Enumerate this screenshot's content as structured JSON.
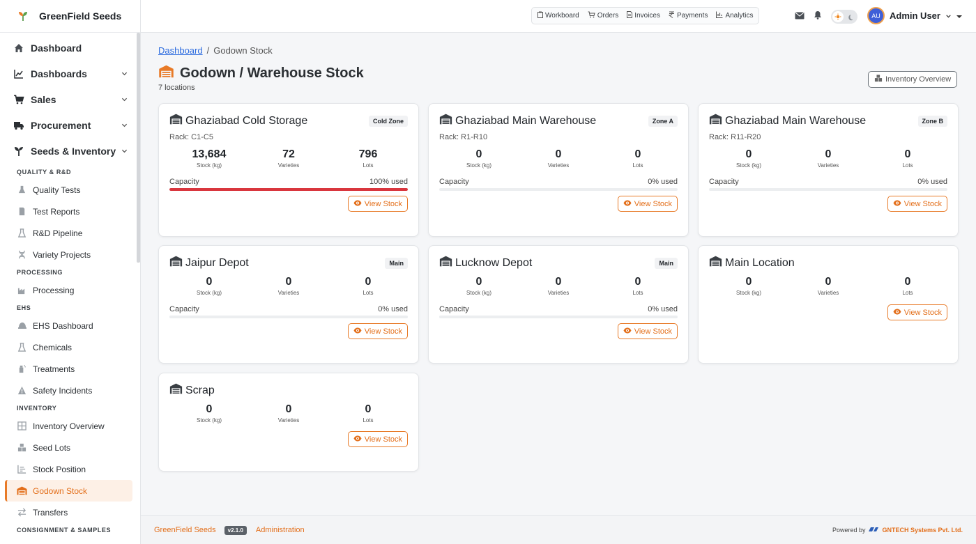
{
  "app": {
    "name": "GreenField Seeds"
  },
  "sidebar": {
    "main_items": [
      {
        "label": "Dashboard"
      },
      {
        "label": "Dashboards"
      },
      {
        "label": "Sales"
      },
      {
        "label": "Procurement"
      },
      {
        "label": "Seeds & Inventory"
      }
    ],
    "sections": [
      {
        "title": "QUALITY & R&D",
        "items": [
          "Quality Tests",
          "Test Reports",
          "R&D Pipeline",
          "Variety Projects"
        ]
      },
      {
        "title": "PROCESSING",
        "items": [
          "Processing"
        ]
      },
      {
        "title": "EHS",
        "items": [
          "EHS Dashboard",
          "Chemicals",
          "Treatments",
          "Safety Incidents"
        ]
      },
      {
        "title": "INVENTORY",
        "items": [
          "Inventory Overview",
          "Seed Lots",
          "Stock Position",
          "Godown Stock",
          "Transfers"
        ]
      },
      {
        "title": "CONSIGNMENT & SAMPLES",
        "items": []
      }
    ],
    "active_item": "Godown Stock"
  },
  "topbar": {
    "quick_nav": [
      "Workboard",
      "Orders",
      "Invoices",
      "Payments",
      "Analytics"
    ],
    "user": {
      "initials": "AU",
      "name": "Admin User"
    }
  },
  "breadcrumb": {
    "home": "Dashboard",
    "separator": "/",
    "current": "Godown Stock"
  },
  "page": {
    "title": "Godown / Warehouse Stock",
    "subtitle": "7 locations",
    "overview_button": "Inventory Overview"
  },
  "labels": {
    "stock": "Stock (kg)",
    "varieties": "Varieties",
    "lots": "Lots",
    "capacity": "Capacity",
    "view": "View Stock"
  },
  "warehouses": [
    {
      "name": "Ghaziabad Cold Storage",
      "badge": "Cold Zone",
      "rack": "Rack: C1-C5",
      "stock": "13,684",
      "varieties": "72",
      "lots": "796",
      "capacity_text": "100% used",
      "capacity_pct": 100
    },
    {
      "name": "Ghaziabad Main Warehouse",
      "badge": "Zone A",
      "rack": "Rack: R1-R10",
      "stock": "0",
      "varieties": "0",
      "lots": "0",
      "capacity_text": "0% used",
      "capacity_pct": 0
    },
    {
      "name": "Ghaziabad Main Warehouse",
      "badge": "Zone B",
      "rack": "Rack: R11-R20",
      "stock": "0",
      "varieties": "0",
      "lots": "0",
      "capacity_text": "0% used",
      "capacity_pct": 0
    },
    {
      "name": "Jaipur Depot",
      "badge": "Main",
      "rack": "",
      "stock": "0",
      "varieties": "0",
      "lots": "0",
      "capacity_text": "0% used",
      "capacity_pct": 0
    },
    {
      "name": "Lucknow Depot",
      "badge": "Main",
      "rack": "",
      "stock": "0",
      "varieties": "0",
      "lots": "0",
      "capacity_text": "0% used",
      "capacity_pct": 0
    },
    {
      "name": "Main Location",
      "badge": "",
      "rack": "",
      "stock": "0",
      "varieties": "0",
      "lots": "0",
      "capacity_text": "",
      "capacity_pct": null
    },
    {
      "name": "Scrap",
      "badge": "",
      "rack": "",
      "stock": "0",
      "varieties": "0",
      "lots": "0",
      "capacity_text": "",
      "capacity_pct": null
    }
  ],
  "footer": {
    "brand": "GreenField Seeds",
    "version": "v2.1.0",
    "admin": "Administration",
    "powered_by": "Powered by",
    "company": "GNTECH Systems Pvt. Ltd."
  },
  "colors": {
    "accent": "#e87a27",
    "capacity_full": "#d9363e",
    "link": "#2d6cdf"
  },
  "icons": {
    "main": [
      "home-icon",
      "chart-line-icon",
      "cart-icon",
      "truck-icon",
      "seedling-icon"
    ],
    "quick_nav": [
      "clipboard-icon",
      "cart-icon",
      "file-icon",
      "payment-icon",
      "analytics-icon"
    ]
  }
}
